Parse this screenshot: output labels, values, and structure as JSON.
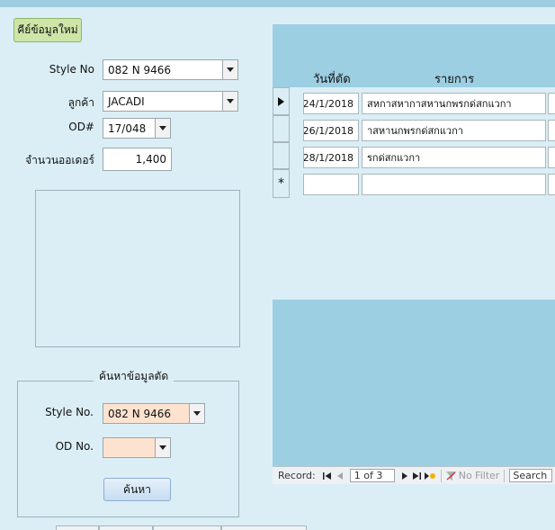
{
  "toolbar": {
    "new_entry_label": "คีย์ข้อมูลใหม่"
  },
  "form": {
    "style_no_label": "Style No",
    "style_no_value": "082 N 9466",
    "customer_label": "ลูกค้า",
    "customer_value": "JACADI",
    "od_label": "OD#",
    "od_value": "17/048",
    "order_qty_label": "จำนวนออเดอร์",
    "order_qty_value": "1,400"
  },
  "search_group": {
    "title": "ค้นหาข้อมูลตัด",
    "style_no_label": "Style No.",
    "style_no_value": "082 N 9466",
    "od_no_label": "OD No.",
    "od_no_value": "",
    "search_button": "ค้นหา"
  },
  "subform": {
    "columns": [
      "วันที่ตัด",
      "รายการ"
    ],
    "rows": [
      {
        "date": "24/1/2018",
        "item": "สหกาสหากาสหานกพรกด่สกแวกา"
      },
      {
        "date": "26/1/2018",
        "item": "าสหานกพรกด่สกแวกา"
      },
      {
        "date": "28/1/2018",
        "item": "รกด่สกแวกา"
      }
    ],
    "new_row_marker": "*"
  },
  "navigation": {
    "record_label": "Record:",
    "record_value": "1 of 3",
    "no_filter_label": "No Filter",
    "search_label": "Search"
  },
  "colors": {
    "background": "#dbeef6",
    "header_band": "#9ccfe2",
    "new_button": "#cfe5a8",
    "highlight_field": "#fde3cf"
  }
}
